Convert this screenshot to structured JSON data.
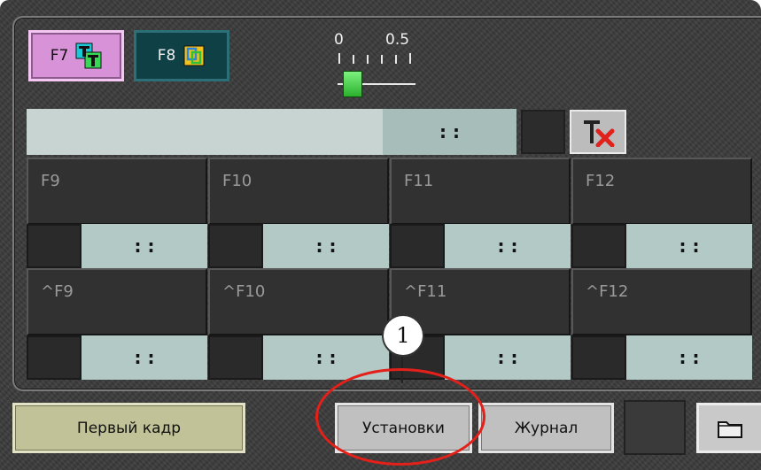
{
  "top_bar": {
    "f7": {
      "label": "F7",
      "icon": "text-layers-icon"
    },
    "f8": {
      "label": "F8",
      "icon": "overlay-icon"
    },
    "slider": {
      "min_label": "0",
      "max_label": "0.5",
      "value": 0.0
    }
  },
  "main_timer": {
    "value": ":   :"
  },
  "slots": [
    {
      "label": "F9",
      "time": ":   :"
    },
    {
      "label": "F10",
      "time": ":   :"
    },
    {
      "label": "F11",
      "time": ":   :"
    },
    {
      "label": "F12",
      "time": ":   :"
    },
    {
      "label": "^F9",
      "time": ":   :"
    },
    {
      "label": "^F10",
      "time": ":   :"
    },
    {
      "label": "^F11",
      "time": ":   :"
    },
    {
      "label": "^F12",
      "time": ":   :"
    }
  ],
  "bottom_bar": {
    "first_frame": "Первый кадр",
    "settings": "Установки",
    "journal": "Журнал",
    "folder_icon": "folder-icon"
  },
  "callout": {
    "number": "1"
  },
  "colors": {
    "background": "#3a3a3a",
    "f7": "#d892d8",
    "f8": "#0e4046",
    "time_cell": "#b3c9c6",
    "first_frame": "#c2c299",
    "highlight": "#e3201a"
  }
}
